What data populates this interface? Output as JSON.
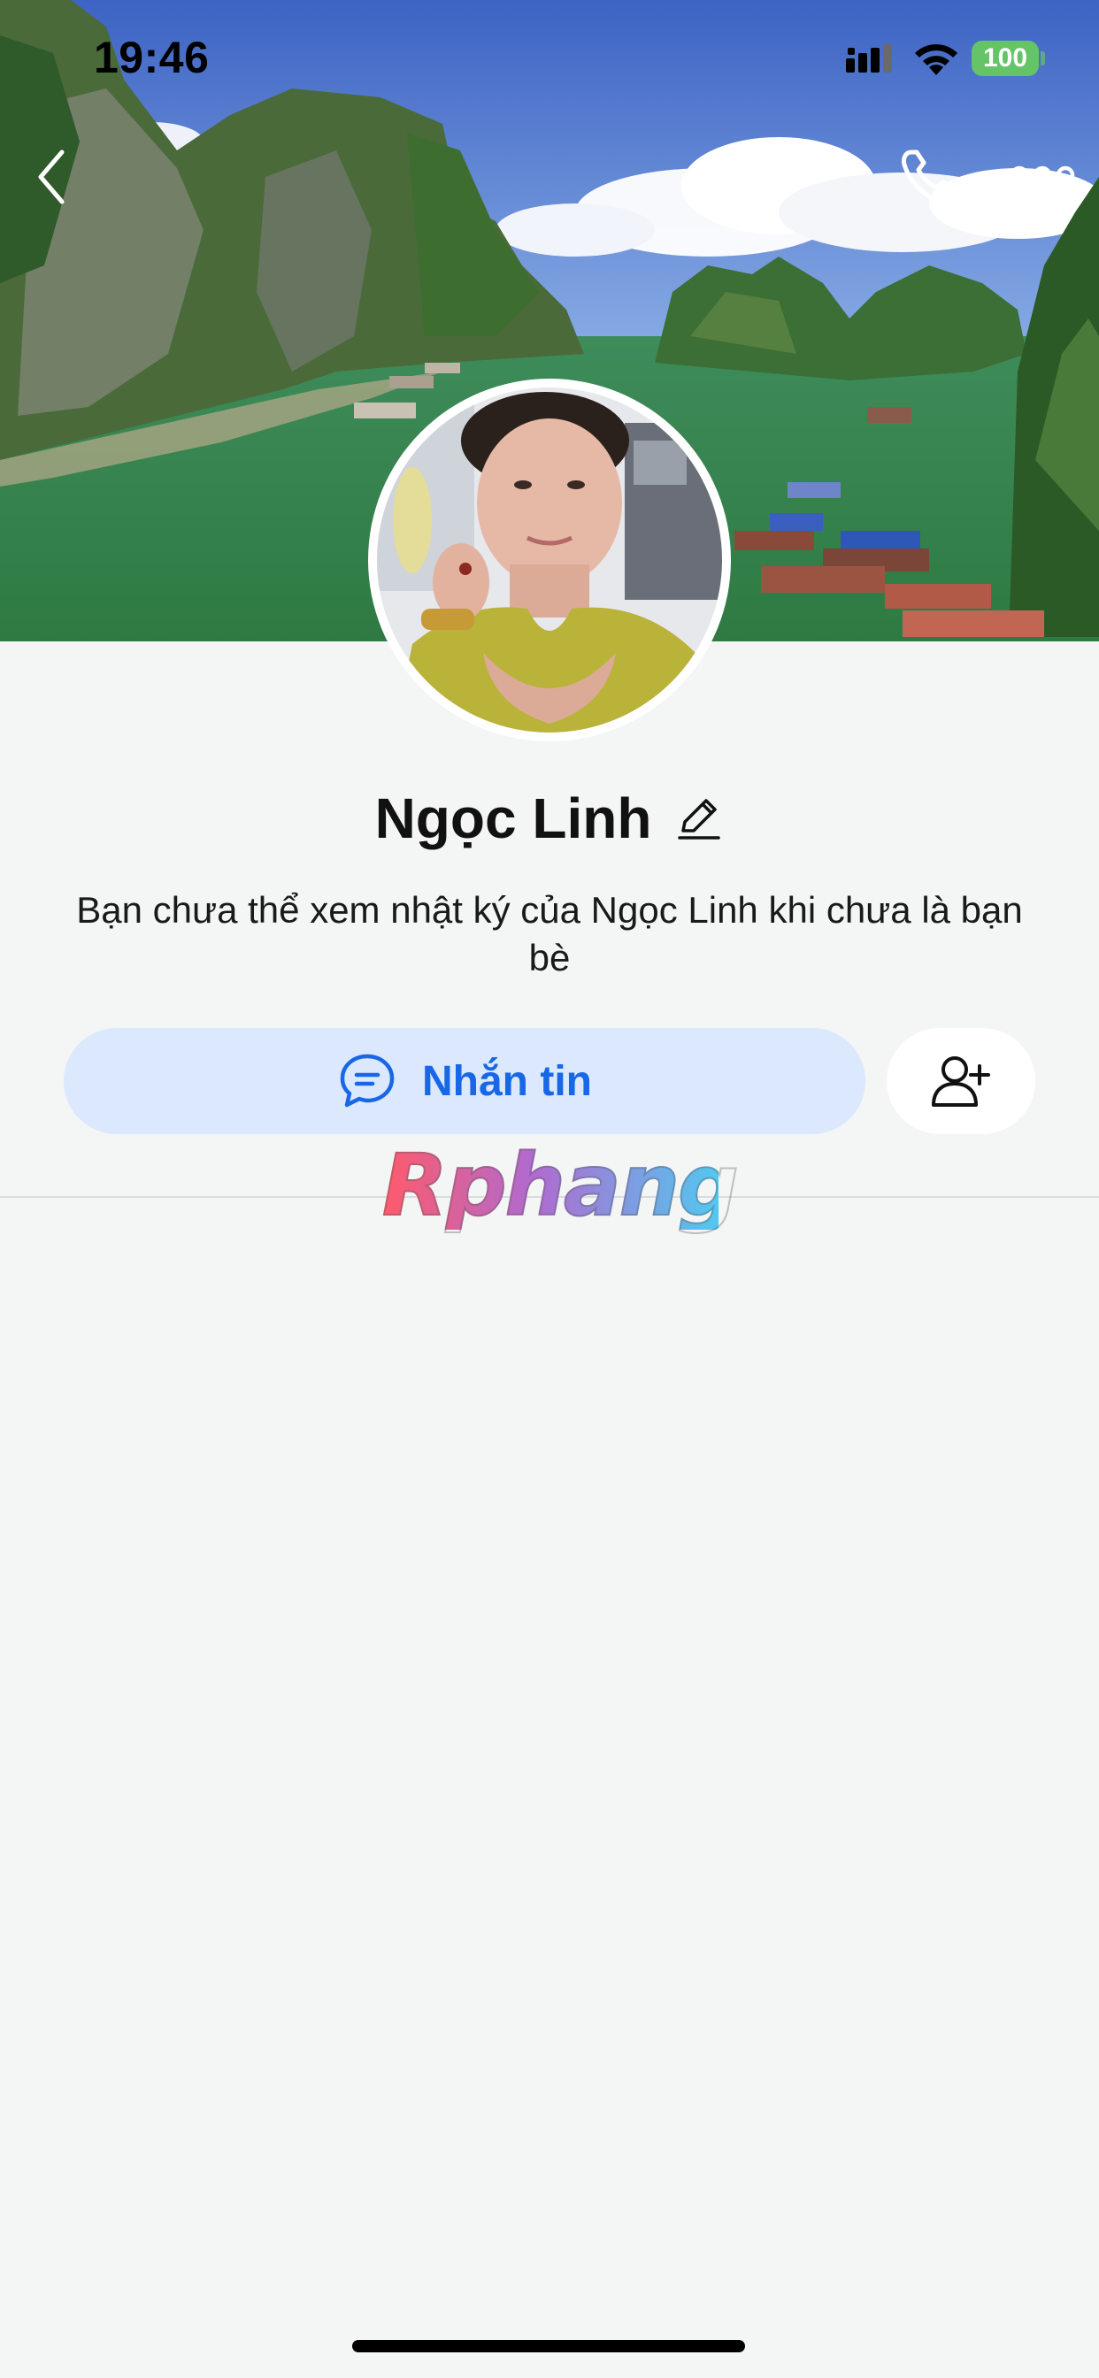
{
  "status_bar": {
    "time": "19:46",
    "battery": "100",
    "icons": [
      "signal-icon",
      "wifi-icon",
      "battery-icon"
    ]
  },
  "nav": {
    "icons": [
      "back-arrow-icon",
      "phone-icon",
      "more-dots-icon"
    ]
  },
  "profile": {
    "name": "Ngọc Linh",
    "privacy_note": "Bạn chưa thể xem nhật ký của Ngọc Linh khi chưa là bạn bè"
  },
  "actions": {
    "message_label": "Nhắn tin",
    "icons": [
      "chat-bubble-icon",
      "add-friend-icon",
      "edit-pencil-icon"
    ]
  },
  "watermark": {
    "text": "Rphang"
  },
  "colors": {
    "accent": "#1867e6",
    "message_button_bg": "#dbe8fd",
    "background": "#f4f5f5",
    "battery": "#65c466"
  }
}
